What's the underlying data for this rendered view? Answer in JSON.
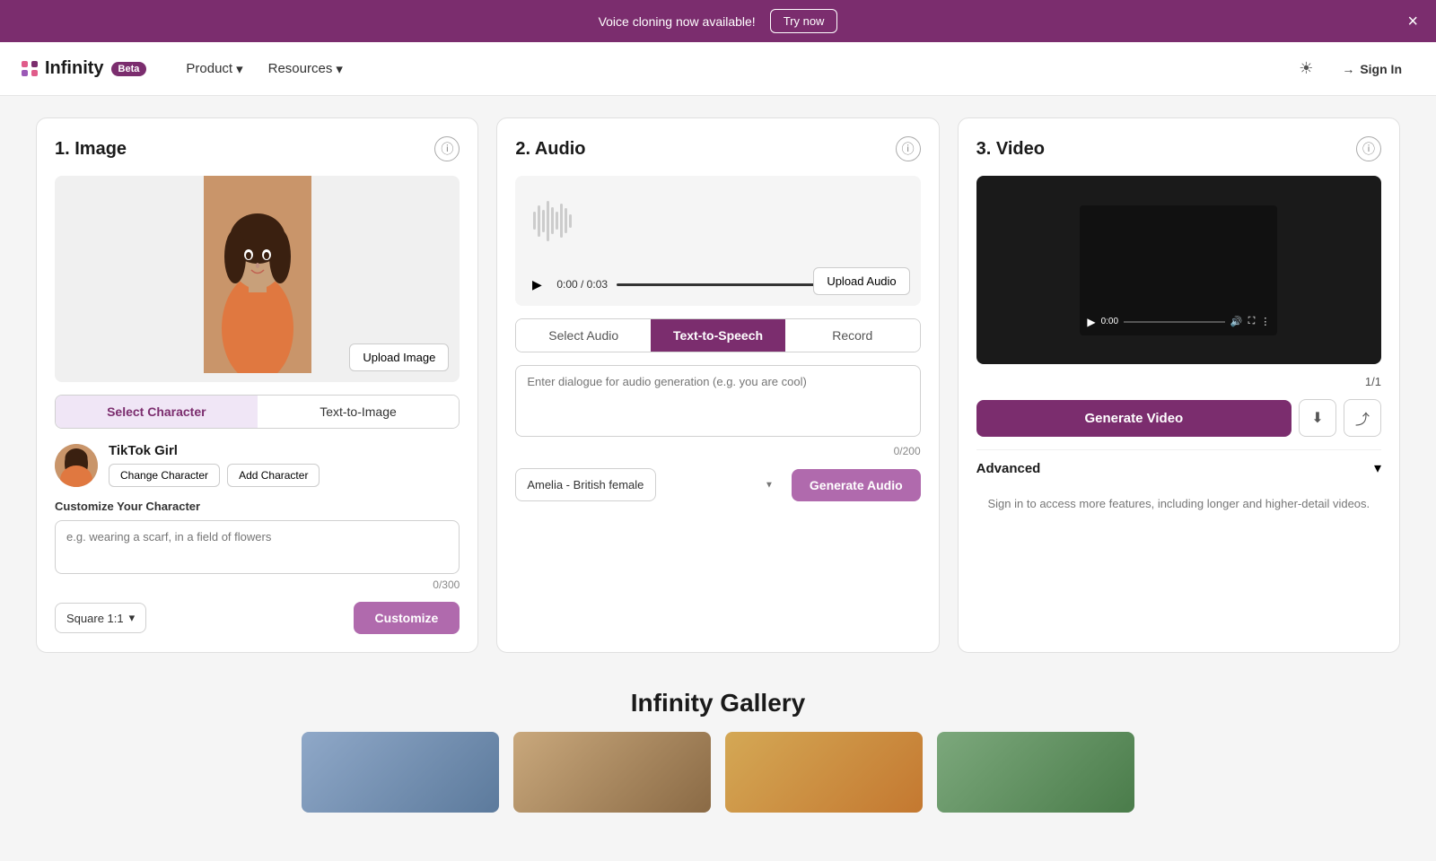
{
  "banner": {
    "text": "Voice cloning now available!",
    "try_label": "Try now",
    "close_label": "×"
  },
  "navbar": {
    "brand": "Infinity",
    "beta_label": "Beta",
    "product_label": "Product",
    "resources_label": "Resources",
    "theme_icon": "☀",
    "signin_label": "Sign In"
  },
  "image_card": {
    "title": "1. Image",
    "upload_label": "Upload Image",
    "tab_select": "Select Character",
    "tab_text_to_image": "Text-to-Image",
    "character_name": "TikTok Girl",
    "change_char_label": "Change Character",
    "add_char_label": "Add Character",
    "customize_label": "Customize Your Character",
    "customize_placeholder": "e.g. wearing a scarf, in a field of flowers",
    "char_count": "0/300",
    "aspect_label": "Square 1:1",
    "customize_btn": "Customize"
  },
  "audio_card": {
    "title": "2. Audio",
    "upload_label": "Upload Audio",
    "tab_select": "Select Audio",
    "tab_tts": "Text-to-Speech",
    "tab_record": "Record",
    "dialogue_placeholder": "Enter dialogue for audio generation (e.g. you are cool)",
    "char_count": "0/200",
    "audio_time": "0:00 / 0:03",
    "voice_label": "Amelia - British female",
    "gen_audio_btn": "Generate Audio"
  },
  "video_card": {
    "title": "3. Video",
    "video_time": "0:00",
    "page_label": "1/1",
    "gen_video_btn": "Generate Video",
    "advanced_label": "Advanced",
    "advanced_note": "Sign in to access more features, including longer and higher-detail videos."
  },
  "gallery": {
    "title": "Infinity Gallery"
  }
}
